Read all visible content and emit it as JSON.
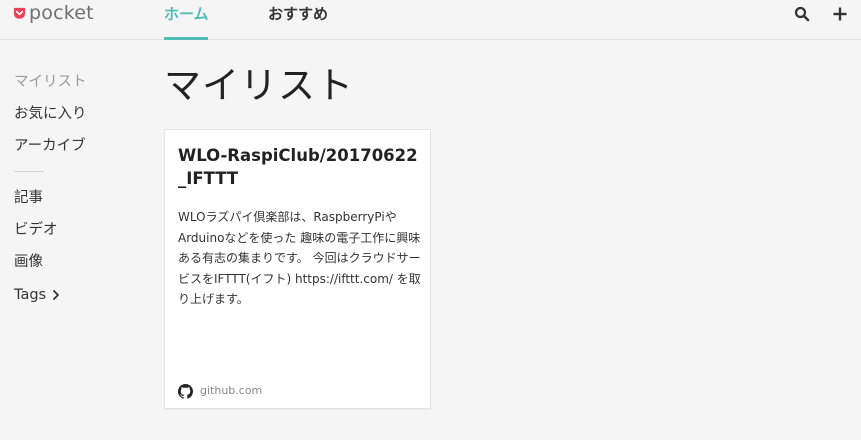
{
  "header": {
    "logo_text": "pocket",
    "tabs": [
      {
        "label": "ホーム",
        "active": true
      },
      {
        "label": "おすすめ",
        "active": false
      }
    ],
    "icons": [
      "search-icon",
      "add-icon"
    ],
    "accent_color": "#50bcb6",
    "brand_color": "#ef4056"
  },
  "sidebar": {
    "primary": [
      {
        "label": "マイリスト",
        "active": true
      },
      {
        "label": "お気に入り"
      },
      {
        "label": "アーカイブ"
      }
    ],
    "secondary": [
      {
        "label": "記事"
      },
      {
        "label": "ビデオ"
      },
      {
        "label": "画像"
      },
      {
        "label": "Tags"
      }
    ]
  },
  "main": {
    "title": "マイリスト",
    "cards": [
      {
        "title": "WLO-RaspiClub/20170622_IFTTT",
        "excerpt": "WLOラズパイ倶楽部は、RaspberryPiやArduinoなどを使った 趣味の電子工作に興味ある有志の集まりです。 今回はクラウドサービスをIFTTT(イフト) https://ifttt.com/ を取り上げます。",
        "source_icon": "github-icon",
        "domain": "github.com"
      }
    ]
  }
}
